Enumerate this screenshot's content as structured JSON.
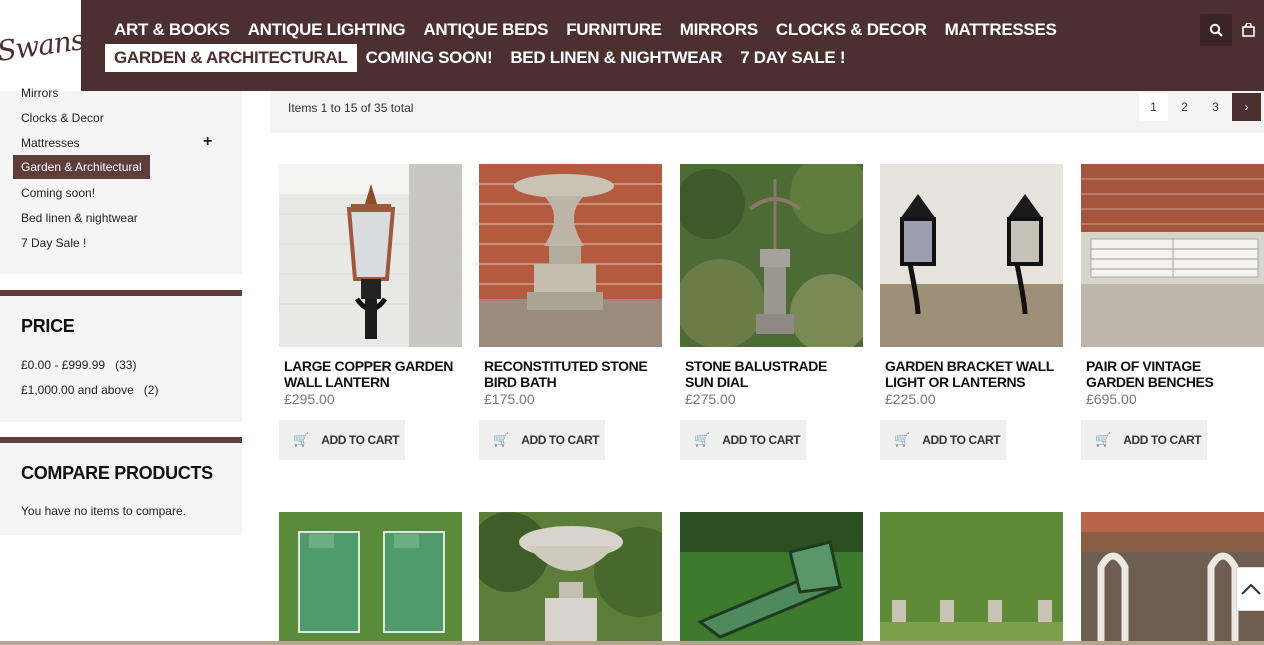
{
  "logo_text": "Swans",
  "nav": {
    "row1": [
      "ART & BOOKS",
      "ANTIQUE LIGHTING",
      "ANTIQUE BEDS",
      "FURNITURE",
      "MIRRORS",
      "CLOCKS & DECOR",
      "MATTRESSES"
    ],
    "row2": [
      "GARDEN & ARCHITECTURAL",
      "COMING SOON!",
      "BED LINEN & NIGHTWEAR",
      "7 DAY SALE !"
    ],
    "active": "GARDEN & ARCHITECTURAL"
  },
  "icons": {
    "search": "search-icon",
    "cart": "shopping-bag-icon"
  },
  "colors": {
    "brand": "#4c2f2f",
    "accent": "#5e3d3a",
    "panel": "#f5f5f5"
  },
  "sidebar": {
    "categories": [
      "Mirrors",
      "Clocks & Decor",
      "Mattresses",
      "Garden & Architectural",
      "Coming soon!",
      "Bed linen & nightwear",
      "7 Day Sale !"
    ],
    "active_category": "Garden & Architectural",
    "price": {
      "title": "PRICE",
      "ranges": [
        {
          "label": "£0.00 - £999.99",
          "count": "(33)"
        },
        {
          "label": "£1,000.00 and above",
          "count": "(2)"
        }
      ]
    },
    "compare": {
      "title": "COMPARE PRODUCTS",
      "text": "You have no items to compare."
    }
  },
  "toolbar": {
    "count": "Items 1 to 15 of 35 total",
    "pages": [
      "1",
      "2",
      "3"
    ],
    "current_page": "1",
    "next": "›"
  },
  "add_to_cart": "ADD TO CART",
  "products": [
    {
      "name": "LARGE COPPER GARDEN WALL LANTERN",
      "price": "£295.00"
    },
    {
      "name": "RECONSTITUTED STONE BIRD BATH",
      "price": "£175.00"
    },
    {
      "name": "STONE BALUSTRADE SUN DIAL",
      "price": "£275.00"
    },
    {
      "name": "GARDEN BRACKET WALL LIGHT OR LANTERNS",
      "price": "£225.00"
    },
    {
      "name": "PAIR OF VINTAGE GARDEN BENCHES",
      "price": "£695.00"
    }
  ]
}
